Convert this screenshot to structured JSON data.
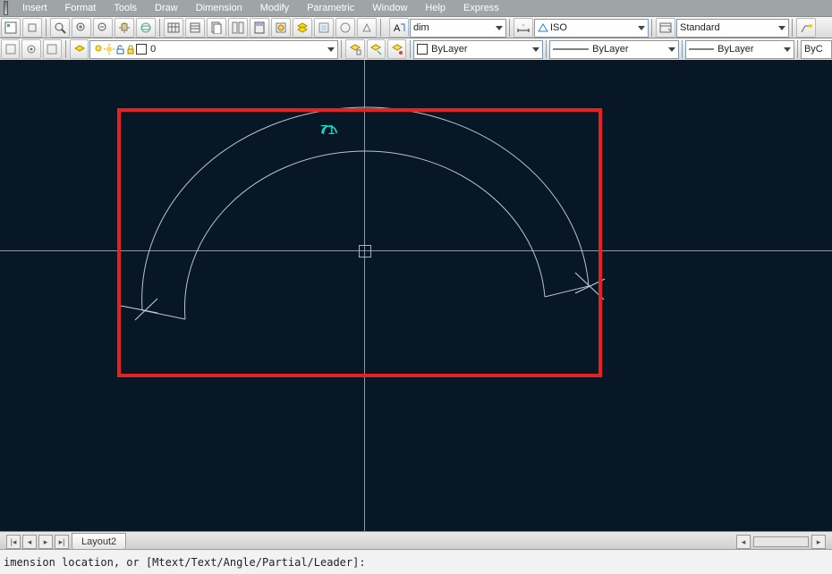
{
  "menu": [
    "Insert",
    "Format",
    "Tools",
    "Draw",
    "Dimension",
    "Modify",
    "Parametric",
    "Window",
    "Help",
    "Express"
  ],
  "row1": {
    "dropdown_dim": "dim",
    "dropdown_iso": "ISO",
    "dropdown_std": "Standard"
  },
  "row2": {
    "layer_dd": "0",
    "prop1": "ByLayer",
    "prop2": "ByLayer",
    "prop3": "ByLayer",
    "prop4": "ByC"
  },
  "dim_text": "71",
  "layout_tab": "Layout2",
  "command_line": "imension location, or [Mtext/Text/Angle/Partial/Leader]:"
}
